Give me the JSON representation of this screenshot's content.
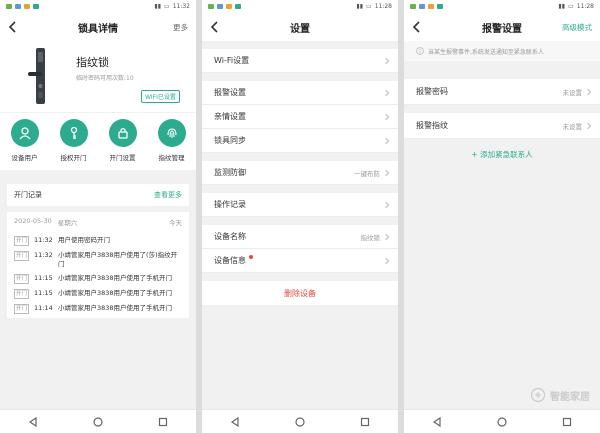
{
  "status": {
    "p1_time": "11:32",
    "p2_time": "11:28",
    "p3_time": "11:28"
  },
  "lock_detail": {
    "title": "锁具详情",
    "more": "更多",
    "lock_name": "指纹锁",
    "lock_sub": "临时密码可用次数:10",
    "wifi_badge": "WIFI已设置",
    "actions": [
      "设备用户",
      "授权开门",
      "开门设置",
      "指纹管理"
    ],
    "records_title": "开门记录",
    "records_more": "查看更多",
    "log_date": "2020-05-30",
    "log_weekday": "星期六",
    "log_today": "今天",
    "log_tag": "开门",
    "logs": [
      {
        "time": "11:32",
        "text": "用户使用密码开门"
      },
      {
        "time": "11:32",
        "text": "小靖管家用户3838用户使用了(莎)指纹开门"
      },
      {
        "time": "11:15",
        "text": "小靖管家用户3838用户使用了手机开门"
      },
      {
        "time": "11:15",
        "text": "小靖管家用户3838用户使用了手机开门"
      },
      {
        "time": "11:14",
        "text": "小靖管家用户3838用户使用了手机开门"
      }
    ]
  },
  "settings": {
    "title": "设置",
    "wifi": "Wi-Fi设置",
    "alarm": "报警设置",
    "family": "亲情设置",
    "sync": "锁具同步",
    "monitor": "监测防御",
    "monitor_value": "一键布防",
    "oplog": "操作记录",
    "devname": "设备名称",
    "devname_value": "指纹锁",
    "devinfo": "设备信息",
    "delete": "删除设备"
  },
  "alarm_settings": {
    "title": "报警设置",
    "advanced": "高级模式",
    "notice": "当某生报警事件,系统发送通知至紧急联系人",
    "pwd": "报警密码",
    "pwd_value": "未设置",
    "fp": "报警指纹",
    "fp_value": "未设置",
    "add_contact": "+ 添加紧急联系人"
  },
  "watermark": "智能家居",
  "colors": {
    "accent": "#2dab8e",
    "danger": "#e0493c"
  }
}
